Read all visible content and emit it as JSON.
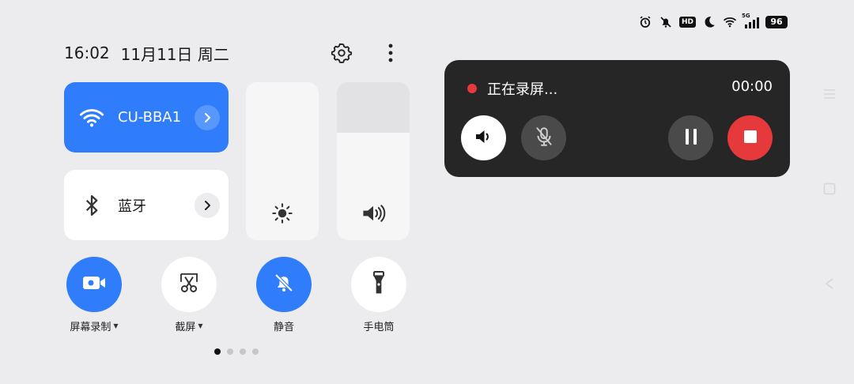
{
  "status_bar": {
    "icons": [
      "alarm-icon",
      "bell-off-icon",
      "hd-icon",
      "moon-icon",
      "wifi-icon",
      "signal-5g-icon"
    ],
    "hd": "HD",
    "network_tag": "5G",
    "battery": "96"
  },
  "header": {
    "time": "16:02",
    "date": "11月11日 周二",
    "settings_icon": "gear-icon",
    "more_icon": "more-vertical-icon"
  },
  "tiles": {
    "wifi": {
      "label": "CU-BBA1",
      "icon": "wifi-icon",
      "active": true
    },
    "bluetooth": {
      "label": "蓝牙",
      "icon": "bluetooth-icon",
      "active": false
    }
  },
  "sliders": {
    "brightness": {
      "icon": "sun-icon",
      "level": 1.0
    },
    "volume": {
      "icon": "speaker-icon",
      "level": 0.68
    }
  },
  "toggles": [
    {
      "label": "屏幕录制",
      "icon": "video-camera-icon",
      "on": true,
      "dropdown": true
    },
    {
      "label": "截屏",
      "icon": "scissors-icon",
      "on": false,
      "dropdown": true
    },
    {
      "label": "静音",
      "icon": "bell-off-icon",
      "on": true,
      "dropdown": false
    },
    {
      "label": "手电筒",
      "icon": "flashlight-icon",
      "on": false,
      "dropdown": false
    }
  ],
  "pagination": {
    "current": 1,
    "total": 4
  },
  "recording": {
    "status": "正在录屏...",
    "time": "00:00",
    "buttons": [
      "speaker-icon",
      "mic-off-icon",
      "pause-icon",
      "stop-icon"
    ]
  },
  "colors": {
    "accent": "#2f7dfb",
    "record_red": "#e5393b",
    "panel_bg": "#262626",
    "background": "#ececee"
  }
}
